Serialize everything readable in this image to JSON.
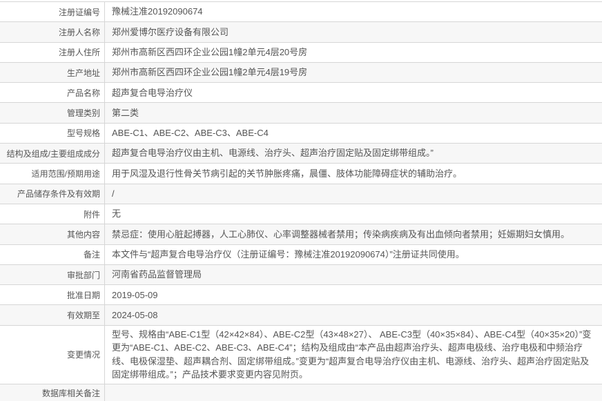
{
  "table": {
    "rows": [
      {
        "label": "注册证编号",
        "value": "豫械注准20192090674"
      },
      {
        "label": "注册人名称",
        "value": "郑州爱博尔医疗设备有限公司"
      },
      {
        "label": "注册人住所",
        "value": "郑州市高新区西四环企业公园1幢2单元4层20号房"
      },
      {
        "label": "生产地址",
        "value": "郑州市高新区西四环企业公园1幢2单元4层19号房"
      },
      {
        "label": "产品名称",
        "value": "超声复合电导治疗仪"
      },
      {
        "label": "管理类别",
        "value": "第二类"
      },
      {
        "label": "型号规格",
        "value": "ABE-C1、ABE-C2、ABE-C3、ABE-C4"
      },
      {
        "label": "结构及组成/主要组成成分",
        "value": "超声复合电导治疗仪由主机、电源线、治疗头、超声治疗固定贴及固定绑带组成。”"
      },
      {
        "label": "适用范围/预期用途",
        "value": "用于风湿及退行性骨关节病引起的关节肿胀疼痛，晨僵、肢体功能障碍症状的辅助治疗。"
      },
      {
        "label": "产品储存条件及有效期",
        "value": "/"
      },
      {
        "label": "附件",
        "value": "无"
      },
      {
        "label": "其他内容",
        "value": "禁忌症：使用心脏起搏器，人工心肺仪、心率调整器械者禁用；传染病疾病及有出血倾向者禁用；妊娠期妇女慎用。"
      },
      {
        "label": "备注",
        "value": "本文件与“超声复合电导治疗仪（注册证编号：豫械注准20192090674）”注册证共同使用。"
      },
      {
        "label": "审批部门",
        "value": "河南省药品监督管理局"
      },
      {
        "label": "批准日期",
        "value": "2019-05-09"
      },
      {
        "label": "有效期至",
        "value": "2024-05-08"
      },
      {
        "label": "变更情况",
        "value": "型号、规格由“ABE-C1型（42×42×84）、ABE-C2型（43×48×27）、 ABE-C3型（40×35×84）、ABE-C4型（40×35×20）”变更为“ABE-C1、ABE-C2、ABE-C3、ABE-C4”；结构及组成由“本产品由超声治疗头、超声电极线、治疗电极和中频治疗线、电极保湿垫、超声耦合剂、固定绑带组成。”变更为“超声复合电导治疗仪由主机、电源线、治疗头、超声治疗固定贴及固定绑带组成。”；产品技术要求变更内容见附页。"
      },
      {
        "label": "数据库相关备注",
        "value": ""
      }
    ]
  },
  "colors": {
    "stripe": "#f7f7f7",
    "border": "#d6d6d6",
    "text": "#555555"
  }
}
